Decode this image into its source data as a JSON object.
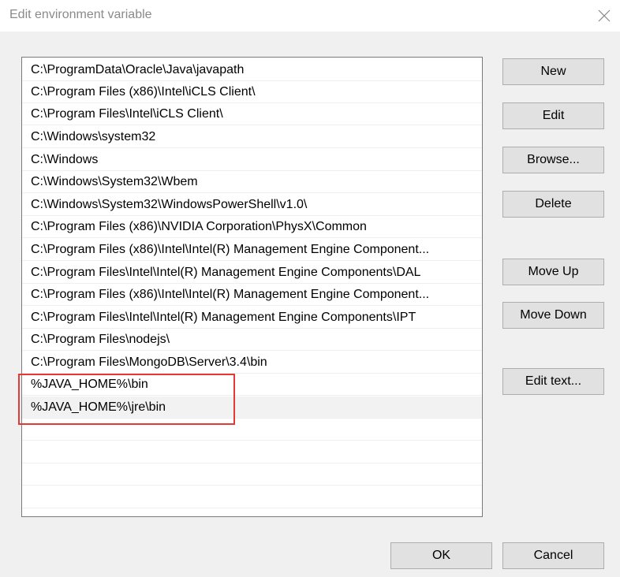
{
  "window": {
    "title": "Edit environment variable"
  },
  "paths": [
    "C:\\ProgramData\\Oracle\\Java\\javapath",
    "C:\\Program Files (x86)\\Intel\\iCLS Client\\",
    "C:\\Program Files\\Intel\\iCLS Client\\",
    "C:\\Windows\\system32",
    "C:\\Windows",
    "C:\\Windows\\System32\\Wbem",
    "C:\\Windows\\System32\\WindowsPowerShell\\v1.0\\",
    "C:\\Program Files (x86)\\NVIDIA Corporation\\PhysX\\Common",
    "C:\\Program Files (x86)\\Intel\\Intel(R) Management Engine Component...",
    "C:\\Program Files\\Intel\\Intel(R) Management Engine Components\\DAL",
    "C:\\Program Files (x86)\\Intel\\Intel(R) Management Engine Component...",
    "C:\\Program Files\\Intel\\Intel(R) Management Engine Components\\IPT",
    "C:\\Program Files\\nodejs\\",
    "C:\\Program Files\\MongoDB\\Server\\3.4\\bin",
    "%JAVA_HOME%\\bin",
    "%JAVA_HOME%\\jre\\bin"
  ],
  "buttons": {
    "new": "New",
    "edit": "Edit",
    "browse": "Browse...",
    "delete": "Delete",
    "move_up": "Move Up",
    "move_down": "Move Down",
    "edit_text": "Edit text...",
    "ok": "OK",
    "cancel": "Cancel"
  },
  "colors": {
    "highlight": "#e53935",
    "selected_row": "#f2f2f2"
  }
}
